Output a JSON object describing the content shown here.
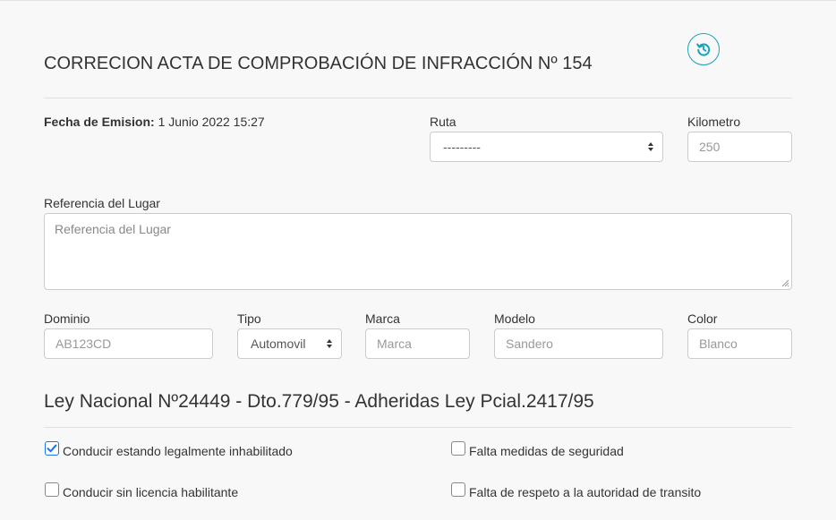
{
  "header": {
    "title": "CORRECION ACTA DE COMPROBACIÓN DE INFRACCIÓN Nº 154",
    "history_icon": "history-icon"
  },
  "emision": {
    "label": "Fecha de Emision:",
    "value": "1 Junio 2022 15:27"
  },
  "fields": {
    "ruta": {
      "label": "Ruta",
      "value": "---------"
    },
    "kilometro": {
      "label": "Kilometro",
      "value": "250"
    },
    "referencia": {
      "label": "Referencia del Lugar",
      "placeholder": "Referencia del Lugar"
    },
    "dominio": {
      "label": "Dominio",
      "value": "AB123CD"
    },
    "tipo": {
      "label": "Tipo",
      "value": "Automovil"
    },
    "marca": {
      "label": "Marca",
      "placeholder": "Marca"
    },
    "modelo": {
      "label": "Modelo",
      "value": "Sandero"
    },
    "color": {
      "label": "Color",
      "value": "Blanco"
    }
  },
  "ley": {
    "title": "Ley Nacional Nº24449 - Dto.779/95 - Adheridas Ley Pcial.2417/95",
    "items": [
      {
        "label": "Conducir estando legalmente inhabilitado",
        "checked": true
      },
      {
        "label": "Falta medidas de seguridad",
        "checked": false
      },
      {
        "label": "Conducir sin licencia habilitante",
        "checked": false
      },
      {
        "label": "Falta de respeto a la autoridad de transito",
        "checked": false
      }
    ]
  },
  "colors": {
    "accent": "#17a2b8",
    "checkbox_checked": "#1a73e8"
  }
}
